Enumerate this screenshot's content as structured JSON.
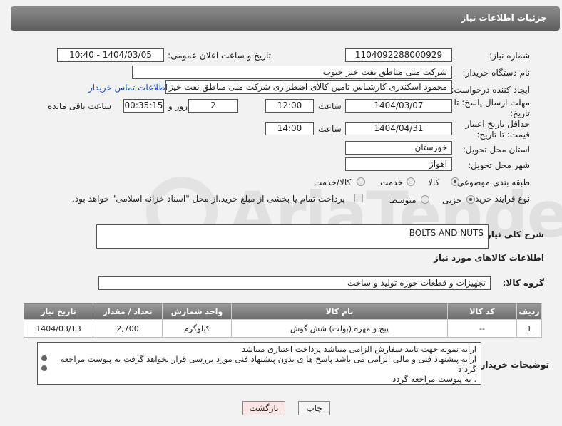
{
  "header": {
    "title": "جزئیات اطلاعات نیاز"
  },
  "fields": {
    "need_number_label": "شماره نیاز:",
    "need_number": "1104092288000929",
    "announce_label": "تاریخ و ساعت اعلان عمومی:",
    "announce_value": "1404/03/05 - 10:40",
    "buyer_org_label": "نام دستگاه خریدار:",
    "buyer_org": "شرکت ملی مناطق نفت خیز جنوب",
    "creator_label": "ایجاد کننده درخواست:",
    "creator": "محمود  اسکندری کارشناس تامین کالای اضطراری شرکت ملی مناطق نفت خیز",
    "contact_link": "اطلاعات تماس خریدار",
    "deadline_label": "مهلت ارسال پاسخ: تا تاریخ:",
    "deadline_date": "1404/03/07",
    "time_word": "ساعت",
    "deadline_time": "12:00",
    "days_value": "2",
    "days_word": "روز و",
    "remaining_time": "00:35:15",
    "remaining_word": "ساعت باقی مانده",
    "price_deadline_label": "حداقل تاریخ اعتبار قیمت: تا تاریخ:",
    "price_date": "1404/04/31",
    "price_time": "14:00",
    "province_label": "استان محل تحویل:",
    "province": "خوزستان",
    "city_label": "شهر محل تحویل:",
    "city": "اهواز",
    "category_label": "طبقه بندی موضوعی:",
    "category_options": [
      "کالا",
      "خدمت",
      "کالا/خدمت"
    ],
    "process_label": "نوع فرآیند خرید :",
    "process_options": [
      "جزیی",
      "متوسط"
    ],
    "payment_note": "پرداخت تمام یا بخشی از مبلغ خرید،از محل \"اسناد خزانه اسلامی\" خواهد بود."
  },
  "description": {
    "label": "شرح کلی نیاز:",
    "value": "BOLTS AND NUTS"
  },
  "goods_info_title": "اطلاعات کالاهای مورد نیاز",
  "goods_group": {
    "label": "گروه کالا:",
    "value": "تجهیزات و قطعات حوزه تولید و ساخت"
  },
  "table": {
    "headers": [
      "ردیف",
      "کد کالا",
      "نام کالا",
      "واحد شمارش",
      "تعداد / مقدار",
      "تاریخ نیاز"
    ],
    "rows": [
      [
        "1",
        "--",
        "پیچ و مهره (بولت) شش گوش",
        "کیلوگرم",
        "2,700",
        "1404/03/13"
      ]
    ]
  },
  "buyer_notes": {
    "label": "توضیحات خریدار:",
    "lines": [
      "ارایه نمونه جهت تایید سفارش الزامی میباشد پرداخت اعتباری میباشد",
      "ارایه پیشنهاد فنی و مالی الزامی می باشد پاسخ ها ی بدون پیشنهاد فنی مورد بررسی قرار نخواهد گرفت به پیوست مراجعه گرد د",
      ". به پیوست مراجعه گردد"
    ]
  },
  "buttons": {
    "print": "چاپ",
    "back": "بازگشت"
  },
  "watermark": "AriaTender.neT"
}
